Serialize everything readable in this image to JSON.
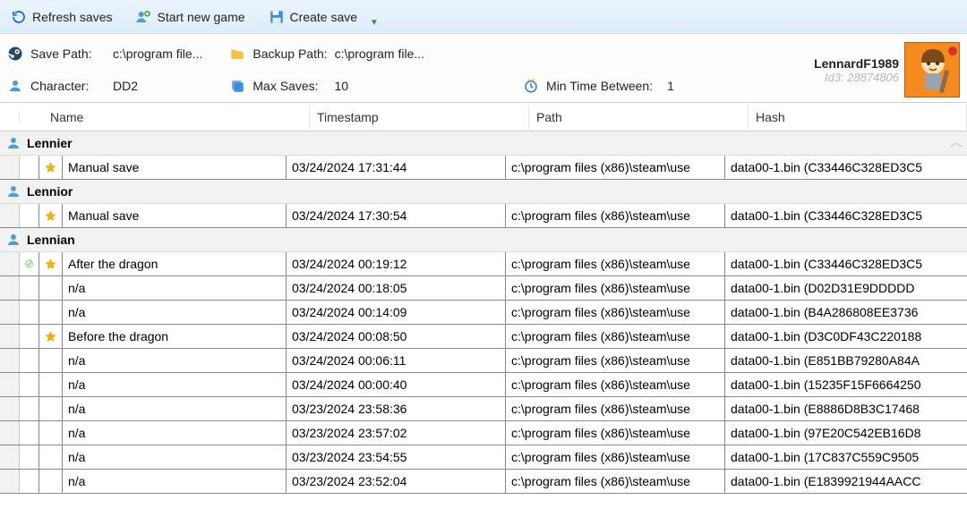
{
  "toolbar": {
    "refresh_label": "Refresh saves",
    "new_game_label": "Start new game",
    "create_save_label": "Create save"
  },
  "info": {
    "save_path_label": "Save Path:",
    "save_path_value": "c:\\program file...",
    "backup_path_label": "Backup Path:",
    "backup_path_value": "c:\\program file...",
    "character_label": "Character:",
    "character_value": "DD2",
    "max_saves_label": "Max Saves:",
    "max_saves_value": "10",
    "min_time_label": "Min Time Between:",
    "min_time_value": "1"
  },
  "user": {
    "name": "LennardF1989",
    "id_label": "Id3: 28874806"
  },
  "columns": {
    "name": "Name",
    "timestamp": "Timestamp",
    "path": "Path",
    "hash": "Hash"
  },
  "groups": [
    {
      "name": "Lennier",
      "rows": [
        {
          "active": false,
          "starred": true,
          "name": "Manual save",
          "ts": "03/24/2024 17:31:44",
          "path": "c:\\program files (x86)\\steam\\use",
          "hash": "data00-1.bin (C33446C328ED3C5"
        }
      ]
    },
    {
      "name": "Lennior",
      "rows": [
        {
          "active": false,
          "starred": true,
          "name": "Manual save",
          "ts": "03/24/2024 17:30:54",
          "path": "c:\\program files (x86)\\steam\\use",
          "hash": "data00-1.bin (C33446C328ED3C5"
        }
      ]
    },
    {
      "name": "Lennian",
      "rows": [
        {
          "active": true,
          "starred": true,
          "name": "After the dragon",
          "ts": "03/24/2024 00:19:12",
          "path": "c:\\program files (x86)\\steam\\use",
          "hash": "data00-1.bin (C33446C328ED3C5"
        },
        {
          "active": false,
          "starred": false,
          "name": "n/a",
          "ts": "03/24/2024 00:18:05",
          "path": "c:\\program files (x86)\\steam\\use",
          "hash": "data00-1.bin (D02D31E9DDDDD"
        },
        {
          "active": false,
          "starred": false,
          "name": "n/a",
          "ts": "03/24/2024 00:14:09",
          "path": "c:\\program files (x86)\\steam\\use",
          "hash": "data00-1.bin (B4A286808EE3736"
        },
        {
          "active": false,
          "starred": true,
          "name": "Before the dragon",
          "ts": "03/24/2024 00:08:50",
          "path": "c:\\program files (x86)\\steam\\use",
          "hash": "data00-1.bin (D3C0DF43C220188"
        },
        {
          "active": false,
          "starred": false,
          "name": "n/a",
          "ts": "03/24/2024 00:06:11",
          "path": "c:\\program files (x86)\\steam\\use",
          "hash": "data00-1.bin (E851BB79280A84A"
        },
        {
          "active": false,
          "starred": false,
          "name": "n/a",
          "ts": "03/24/2024 00:00:40",
          "path": "c:\\program files (x86)\\steam\\use",
          "hash": "data00-1.bin (15235F15F6664250"
        },
        {
          "active": false,
          "starred": false,
          "name": "n/a",
          "ts": "03/23/2024 23:58:36",
          "path": "c:\\program files (x86)\\steam\\use",
          "hash": "data00-1.bin (E8886D8B3C17468"
        },
        {
          "active": false,
          "starred": false,
          "name": "n/a",
          "ts": "03/23/2024 23:57:02",
          "path": "c:\\program files (x86)\\steam\\use",
          "hash": "data00-1.bin (97E20C542EB16D8"
        },
        {
          "active": false,
          "starred": false,
          "name": "n/a",
          "ts": "03/23/2024 23:54:55",
          "path": "c:\\program files (x86)\\steam\\use",
          "hash": "data00-1.bin (17C837C559C9505"
        },
        {
          "active": false,
          "starred": false,
          "name": "n/a",
          "ts": "03/23/2024 23:52:04",
          "path": "c:\\program files (x86)\\steam\\use",
          "hash": "data00-1.bin (E1839921944AACC"
        }
      ]
    }
  ]
}
